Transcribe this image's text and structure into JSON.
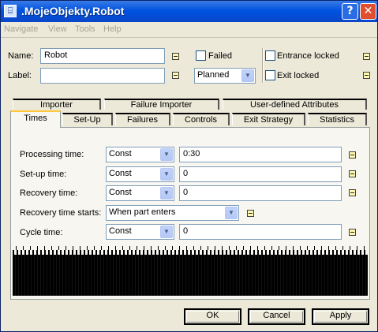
{
  "window": {
    "title": ".MojeObjekty.Robot",
    "help_label": "?",
    "close_label": "✕",
    "menu": [
      "Navigate",
      "View",
      "Tools",
      "Help"
    ]
  },
  "header": {
    "name_label": "Name:",
    "name_value": "Robot",
    "label_label": "Label:",
    "label_value": "",
    "failed_label": "Failed",
    "failed_checked": false,
    "planned_value": "Planned",
    "entrance_locked_label": "Entrance locked",
    "entrance_locked_checked": false,
    "exit_locked_label": "Exit locked",
    "exit_locked_checked": false
  },
  "tabs_back": [
    "Importer",
    "Failure Importer",
    "User-defined Attributes"
  ],
  "tabs_front": [
    "Times",
    "Set-Up",
    "Failures",
    "Controls",
    "Exit Strategy",
    "Statistics"
  ],
  "active_tab": "Times",
  "times": {
    "rows": [
      {
        "label": "Processing time:",
        "type": "Const",
        "value": "0:30"
      },
      {
        "label": "Set-up time:",
        "type": "Const",
        "value": "0"
      },
      {
        "label": "Recovery time:",
        "type": "Const",
        "value": "0"
      },
      {
        "label": "Recovery time starts:",
        "type": "When part enters",
        "value": ""
      },
      {
        "label": "Cycle time:",
        "type": "Const",
        "value": "0"
      }
    ]
  },
  "buttons": {
    "ok": "OK",
    "cancel": "Cancel",
    "apply": "Apply"
  },
  "colors": {
    "titlebar": "#0053e0",
    "dialog": "#ece9d8",
    "panel": "#f7f6f1",
    "field_border": "#7f9db9",
    "active_tab_accent": "#ffc83c"
  }
}
